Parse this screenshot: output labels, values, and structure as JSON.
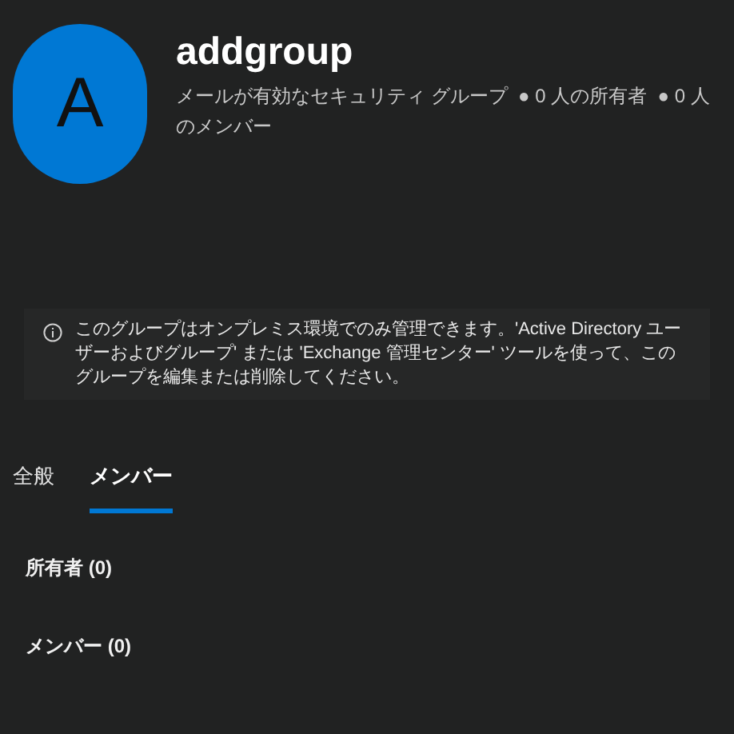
{
  "group": {
    "avatar_letter": "A",
    "name": "addgroup",
    "subtitle": "メールが有効なセキュリティ グループ  ● 0 人の所有者  ● 0 人のメンバー"
  },
  "notice": {
    "text": "このグループはオンプレミス環境でのみ管理できます。'Active Directory ユーザーおよびグループ' または 'Exchange 管理センター' ツールを使って、このグループを編集または削除してください。"
  },
  "tabs": [
    {
      "label": "全般",
      "selected": false
    },
    {
      "label": "メンバー",
      "selected": true
    }
  ],
  "sections": [
    "所有者 (0)",
    "メンバー (0)"
  ]
}
